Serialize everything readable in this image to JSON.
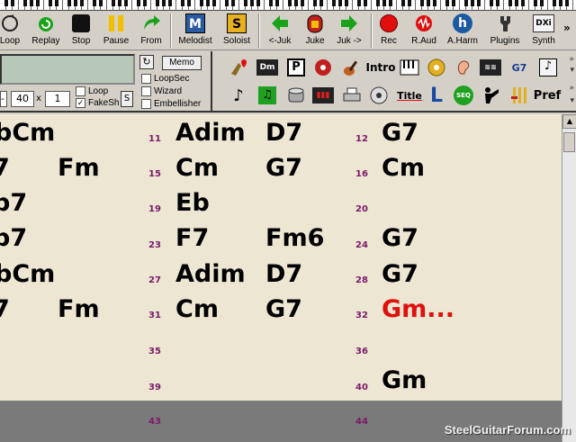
{
  "toolbar": {
    "loop": "Loop",
    "replay": "Replay",
    "stop": "Stop",
    "pause": "Pause",
    "from": "From",
    "melodist": "Melodist",
    "soloist": "Soloist",
    "juke_prev": "<-Juk",
    "juke": "Juke",
    "juke_next": "Juk ->",
    "rec": "Rec",
    "raud": "R.Aud",
    "aharm": "A.Harm",
    "plugins": "Plugins",
    "synth": "Synth",
    "melodist_glyph": "M",
    "soloist_glyph": "S",
    "aharm_glyph": "h",
    "synth_glyph": "DXi"
  },
  "controls": {
    "memo": "Memo",
    "loopsec": "LoopSec",
    "wizard": "Wizard",
    "embellisher": "Embellisher",
    "loop": "Loop",
    "fakesh": "FakeSh",
    "tempo": "40",
    "times": "x",
    "count": "1",
    "s": "S",
    "dash": "-",
    "loopsec_checked": false,
    "wizard_checked": false,
    "embellisher_checked": false,
    "loop_checked": false,
    "fakesh_checked": true
  },
  "icons": {
    "row1": [
      "heart-style-icon",
      "dm-chord-icon",
      "p-icon",
      "audio-icon",
      "guitar-icon",
      "Intro",
      "keyboard-icon",
      "cd-icon",
      "ear-icon",
      "waveform-icon",
      "G7",
      "notation-icon"
    ],
    "row2": [
      "note-icon",
      "green-note-icon",
      "drum-icon",
      "mixer-icon",
      "printer-icon",
      "cd-burn-icon",
      "Title",
      "L",
      "SEQ",
      "guitarist-icon",
      "mixer2-icon",
      "Pref"
    ],
    "labels": {
      "dm": "Dm",
      "p": "P",
      "intro": "Intro",
      "g7": "G7",
      "title": "Title",
      "l": "L",
      "seq": "SEQ",
      "pref": "Pref"
    }
  },
  "sheet": {
    "bars": [
      {
        "num": "11",
        "c1": "Adim",
        "c2": "D7"
      },
      {
        "num": "12",
        "c1": "G7",
        "c2": ""
      },
      {
        "num": "15",
        "c1": "Cm",
        "c2": "G7"
      },
      {
        "num": "16",
        "c1": "Cm",
        "c2": ""
      },
      {
        "num": "19",
        "c1": "Eb",
        "c2": ""
      },
      {
        "num": "20",
        "c1": "",
        "c2": ""
      },
      {
        "num": "23",
        "c1": "F7",
        "c2": "Fm6"
      },
      {
        "num": "24",
        "c1": "G7",
        "c2": ""
      },
      {
        "num": "27",
        "c1": "Adim",
        "c2": "D7"
      },
      {
        "num": "28",
        "c1": "G7",
        "c2": ""
      },
      {
        "num": "31",
        "c1": "Cm",
        "c2": "G7"
      },
      {
        "num": "32",
        "c1": "Gm...",
        "c2": ""
      },
      {
        "num": "35",
        "c1": "",
        "c2": ""
      },
      {
        "num": "36",
        "c1": "",
        "c2": ""
      },
      {
        "num": "39",
        "c1": "",
        "c2": ""
      },
      {
        "num": "40",
        "c1": "Gm",
        "c2": ""
      },
      {
        "num": "43",
        "c1": "",
        "c2": ""
      },
      {
        "num": "44",
        "c1": "",
        "c2": ""
      }
    ],
    "left_partial": [
      {
        "a": "b",
        "b": "Cm"
      },
      {
        "a": "7",
        "b": "Fm"
      },
      {
        "a": "b7",
        "b": ""
      },
      {
        "a": "b7",
        "b": ""
      },
      {
        "a": "b",
        "b": "Cm"
      },
      {
        "a": "7",
        "b": "Fm"
      }
    ]
  },
  "watermark": "SteelGuitarForum.com",
  "colors": {
    "sheet_bg": "#ece6d2",
    "bar_number": "#7a1a6a",
    "highlight_chord": "#e0100c"
  }
}
